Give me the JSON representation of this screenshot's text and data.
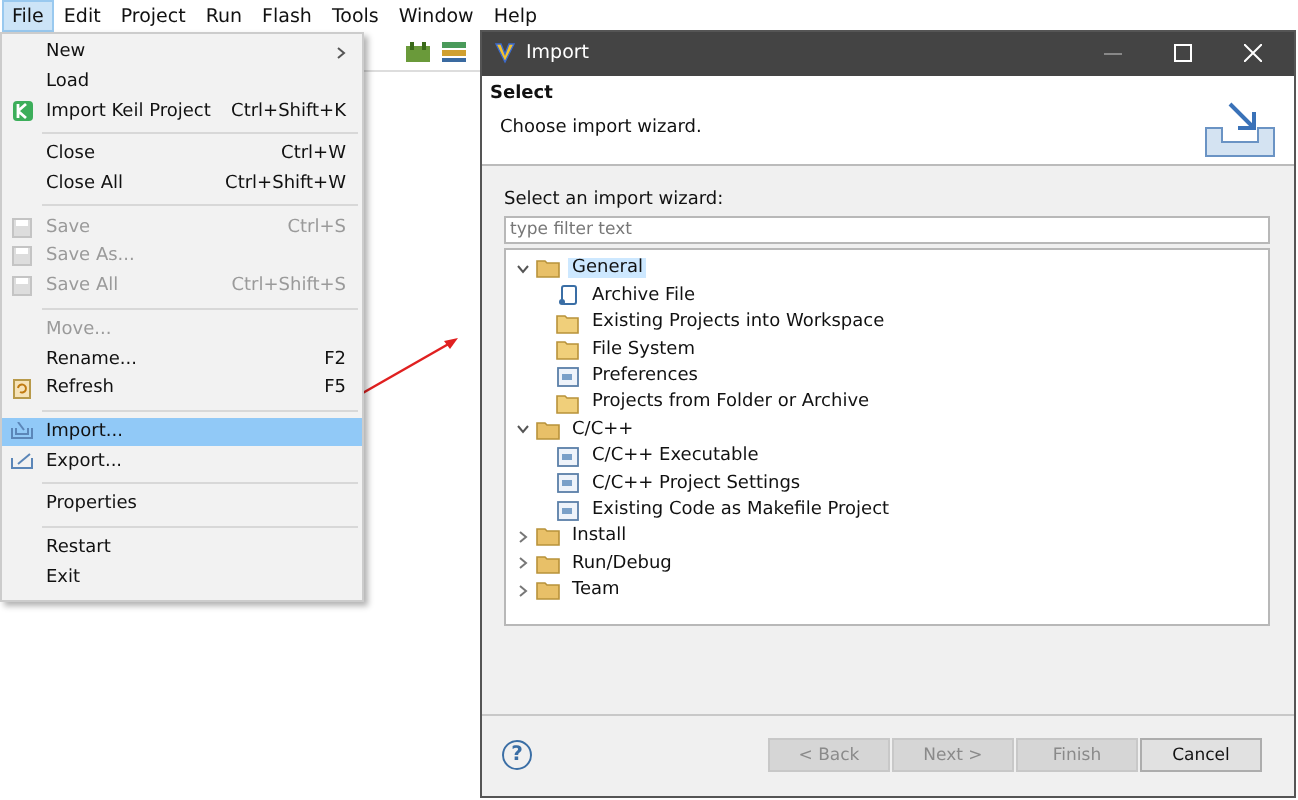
{
  "menu_bar": [
    {
      "label": "File",
      "selected": true
    },
    {
      "label": "Edit",
      "selected": false
    },
    {
      "label": "Project",
      "selected": false
    },
    {
      "label": "Run",
      "selected": false
    },
    {
      "label": "Flash",
      "selected": false
    },
    {
      "label": "Tools",
      "selected": false
    },
    {
      "label": "Window",
      "selected": false
    },
    {
      "label": "Help",
      "selected": false
    }
  ],
  "file_menu": [
    {
      "kind": "item",
      "label": "New",
      "submenu": true,
      "disabled": false,
      "selected": false
    },
    {
      "kind": "item",
      "label": "Load",
      "disabled": false,
      "selected": false
    },
    {
      "kind": "item",
      "label": "Import Keil Project",
      "shortcut": "Ctrl+Shift+K",
      "disabled": false,
      "selected": false
    },
    {
      "kind": "separator"
    },
    {
      "kind": "item",
      "label": "Close",
      "shortcut": "Ctrl+W",
      "disabled": false,
      "selected": false
    },
    {
      "kind": "item",
      "label": "Close All",
      "shortcut": "Ctrl+Shift+W",
      "disabled": false,
      "selected": false
    },
    {
      "kind": "separator"
    },
    {
      "kind": "item",
      "label": "Save",
      "shortcut": "Ctrl+S",
      "disabled": true,
      "selected": false
    },
    {
      "kind": "item",
      "label": "Save As...",
      "disabled": true,
      "selected": false
    },
    {
      "kind": "item",
      "label": "Save All",
      "shortcut": "Ctrl+Shift+S",
      "disabled": true,
      "selected": false
    },
    {
      "kind": "separator"
    },
    {
      "kind": "item",
      "label": "Move...",
      "disabled": true,
      "selected": false
    },
    {
      "kind": "item",
      "label": "Rename...",
      "shortcut": "F2",
      "disabled": false,
      "selected": false
    },
    {
      "kind": "item",
      "label": "Refresh",
      "shortcut": "F5",
      "disabled": false,
      "selected": false
    },
    {
      "kind": "separator"
    },
    {
      "kind": "item",
      "label": "Import...",
      "disabled": false,
      "selected": true
    },
    {
      "kind": "item",
      "label": "Export...",
      "disabled": false,
      "selected": false
    },
    {
      "kind": "separator"
    },
    {
      "kind": "item",
      "label": "Properties",
      "disabled": false,
      "selected": false
    },
    {
      "kind": "separator"
    },
    {
      "kind": "item",
      "label": "Restart",
      "disabled": false,
      "selected": false
    },
    {
      "kind": "item",
      "label": "Exit",
      "disabled": false,
      "selected": false
    }
  ],
  "dialog": {
    "title": "Import",
    "heading": "Select",
    "description": "Choose import wizard.",
    "prompt": "Select an import wizard:",
    "filter": {
      "placeholder": "type filter text"
    },
    "tree": [
      {
        "label": "General",
        "expanded": true,
        "selected": true,
        "children": [
          {
            "label": "Archive File",
            "selected": false
          },
          {
            "label": "Existing Projects into Workspace",
            "selected": false
          },
          {
            "label": "File System",
            "selected": false
          },
          {
            "label": "Preferences",
            "selected": false
          },
          {
            "label": "Projects from Folder or Archive",
            "selected": false
          }
        ]
      },
      {
        "label": "C/C++",
        "expanded": true,
        "selected": false,
        "children": [
          {
            "label": "C/C++ Executable",
            "selected": false
          },
          {
            "label": "C/C++ Project Settings",
            "selected": false
          },
          {
            "label": "Existing Code as Makefile Project",
            "selected": false
          }
        ]
      },
      {
        "label": "Install",
        "expanded": false,
        "selected": false
      },
      {
        "label": "Run/Debug",
        "expanded": false,
        "selected": false
      },
      {
        "label": "Team",
        "expanded": false,
        "selected": false
      }
    ],
    "help": "?",
    "buttons": [
      {
        "label": "< Back",
        "disabled": true
      },
      {
        "label": "Next >",
        "disabled": true
      },
      {
        "label": "Finish",
        "disabled": true
      },
      {
        "label": "Cancel",
        "disabled": false
      }
    ]
  }
}
